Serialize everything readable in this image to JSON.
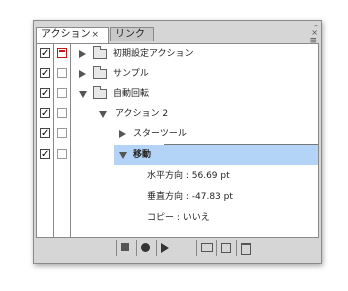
{
  "panel": {
    "tabs": [
      {
        "label": "アクション",
        "close": "×"
      },
      {
        "label": "リンク"
      }
    ],
    "window_controls": {
      "minimize": "–",
      "close": "×"
    },
    "menu_icon": "≡"
  },
  "rows": [
    {
      "checked": true,
      "dialog": "red",
      "label": "初期設定アクション",
      "indent": 0,
      "kind": "set",
      "expanded": false
    },
    {
      "checked": true,
      "dialog": "none",
      "label": "サンプル",
      "indent": 0,
      "kind": "set",
      "expanded": false
    },
    {
      "checked": true,
      "dialog": "none",
      "label": "自動回転",
      "indent": 0,
      "kind": "set",
      "expanded": true
    },
    {
      "checked": true,
      "dialog": "none",
      "label": "アクション 2",
      "indent": 1,
      "kind": "action",
      "expanded": true
    },
    {
      "checked": true,
      "dialog": "none",
      "label": "スターツール",
      "indent": 2,
      "kind": "step",
      "expanded": false
    },
    {
      "checked": true,
      "dialog": "none",
      "label": "移動",
      "indent": 2,
      "kind": "step",
      "expanded": true,
      "selected": true
    },
    {
      "label": "水平方向 : 56.69 pt",
      "indent": 3,
      "kind": "detail"
    },
    {
      "label": "垂直方向 : -47.83 pt",
      "indent": 3,
      "kind": "detail"
    },
    {
      "label": "コピー : いいえ",
      "indent": 3,
      "kind": "detail"
    }
  ],
  "bottom_buttons": [
    "stop-icon",
    "record-icon",
    "play-icon",
    "new-set-icon",
    "new-action-icon",
    "delete-icon"
  ],
  "colors": {
    "selection": "#b3d3f7",
    "dialog_red": "#c01818"
  }
}
